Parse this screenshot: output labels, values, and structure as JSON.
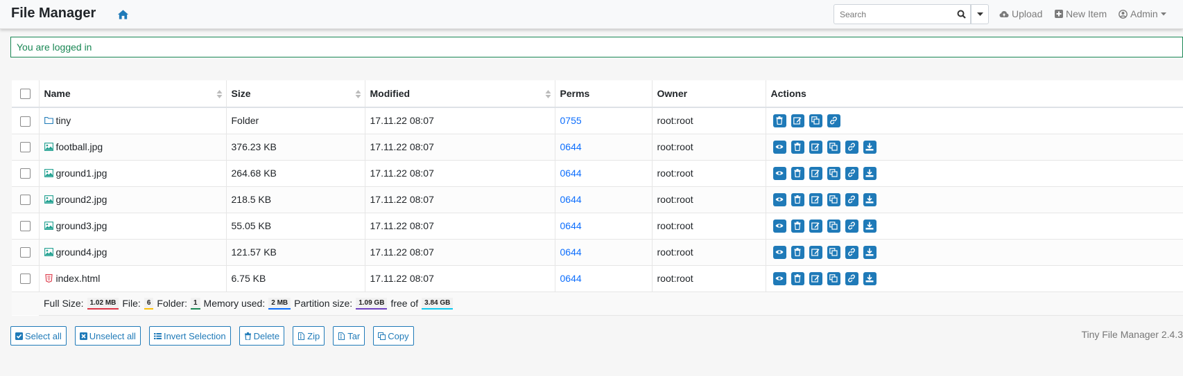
{
  "app": {
    "title": "File Manager",
    "version": "Tiny File Manager 2.4.3"
  },
  "nav": {
    "search_placeholder": "Search",
    "upload_label": "Upload",
    "new_item_label": "New Item",
    "admin_label": "Admin"
  },
  "alert": {
    "message": "You are logged in"
  },
  "table": {
    "headers": {
      "name": "Name",
      "size": "Size",
      "modified": "Modified",
      "perms": "Perms",
      "owner": "Owner",
      "actions": "Actions"
    },
    "rows": [
      {
        "name": "tiny",
        "type": "folder",
        "size": "Folder",
        "modified": "17.11.22 08:07",
        "perms": "0755",
        "owner": "root:root"
      },
      {
        "name": "football.jpg",
        "type": "image",
        "size": "376.23 KB",
        "modified": "17.11.22 08:07",
        "perms": "0644",
        "owner": "root:root"
      },
      {
        "name": "ground1.jpg",
        "type": "image",
        "size": "264.68 KB",
        "modified": "17.11.22 08:07",
        "perms": "0644",
        "owner": "root:root"
      },
      {
        "name": "ground2.jpg",
        "type": "image",
        "size": "218.5 KB",
        "modified": "17.11.22 08:07",
        "perms": "0644",
        "owner": "root:root"
      },
      {
        "name": "ground3.jpg",
        "type": "image",
        "size": "55.05 KB",
        "modified": "17.11.22 08:07",
        "perms": "0644",
        "owner": "root:root"
      },
      {
        "name": "ground4.jpg",
        "type": "image",
        "size": "121.57 KB",
        "modified": "17.11.22 08:07",
        "perms": "0644",
        "owner": "root:root"
      },
      {
        "name": "index.html",
        "type": "html",
        "size": "6.75 KB",
        "modified": "17.11.22 08:07",
        "perms": "0644",
        "owner": "root:root"
      }
    ]
  },
  "summary": {
    "full_size_label": "Full Size:",
    "full_size": "1.02 MB",
    "file_label": "File:",
    "file_count": "6",
    "folder_label": "Folder:",
    "folder_count": "1",
    "memory_label": "Memory used:",
    "memory": "2 MB",
    "partition_label": "Partition size:",
    "partition": "1.09 GB",
    "free_label": "free of",
    "free": "3.84 GB"
  },
  "buttons": {
    "select_all": "Select all",
    "unselect_all": "Unselect all",
    "invert": "Invert Selection",
    "delete": "Delete",
    "zip": "Zip",
    "tar": "Tar",
    "copy": "Copy"
  },
  "colors": {
    "accent": "#1f7ab8",
    "link": "#0d6efd",
    "success": "#198754"
  }
}
